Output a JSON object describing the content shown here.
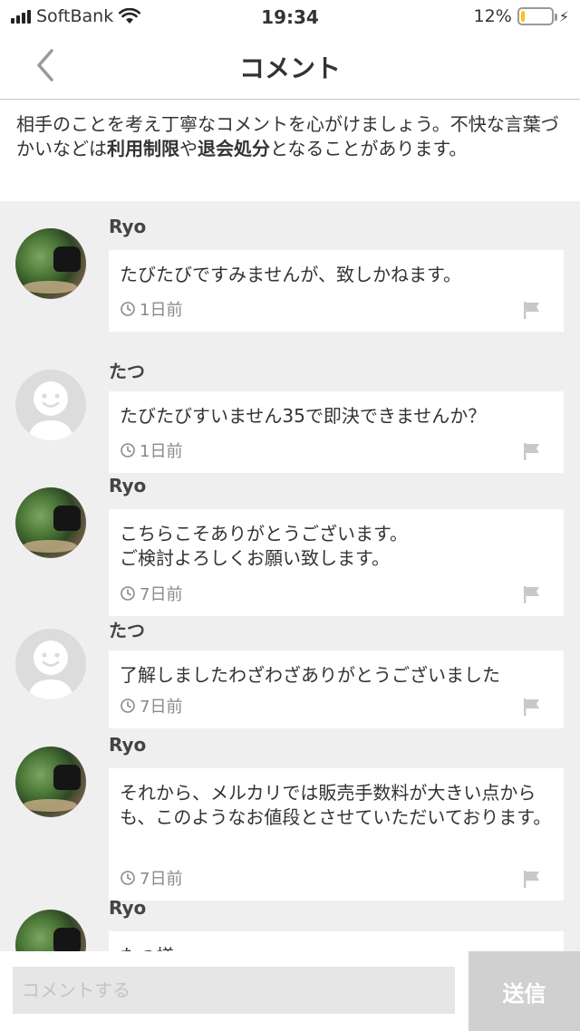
{
  "status_bar": {
    "carrier": "SoftBank",
    "time": "19:34",
    "battery_percent": "12%",
    "battery_level": 0.12,
    "battery_color": "#f5c518",
    "icons": [
      "signal-icon",
      "wifi-icon",
      "battery-icon",
      "charging-bolt-icon"
    ]
  },
  "nav": {
    "title": "コメント",
    "back_icon": "chevron-left-icon"
  },
  "notice": {
    "part1": "相手のことを考え丁寧なコメントを心がけましょう。不快な言葉づかいなどは",
    "bold1": "利用制限",
    "part2": "や",
    "bold2": "退会処分",
    "part3": "となることがあります。"
  },
  "comments": [
    {
      "user": "Ryo",
      "avatar": "photo",
      "text": "たびたびですみませんが、致しかねます。",
      "time": "1日前"
    },
    {
      "user": "たつ",
      "avatar": "default",
      "text": "たびたびすいません35で即決できませんか？",
      "time": "1日前"
    },
    {
      "user": "Ryo",
      "avatar": "photo",
      "text": "こちらこそありがとうございます。\nご検討よろしくお願い致します。",
      "time": "7日前"
    },
    {
      "user": "たつ",
      "avatar": "default",
      "text": "了解しましたわざわざありがとうございました",
      "time": "7日前"
    },
    {
      "user": "Ryo",
      "avatar": "photo",
      "text": "それから、メルカリでは販売手数料が大きい点からも、このようなお値段とさせていただいております。",
      "time": "7日前"
    },
    {
      "user": "Ryo",
      "avatar": "photo",
      "text": "たつ様\nいえ、とんでもございません。",
      "time": ""
    }
  ],
  "input": {
    "placeholder": "コメントする",
    "value": ""
  },
  "send_button": {
    "label": "送信",
    "disabled_color": "#d0d0d0"
  }
}
